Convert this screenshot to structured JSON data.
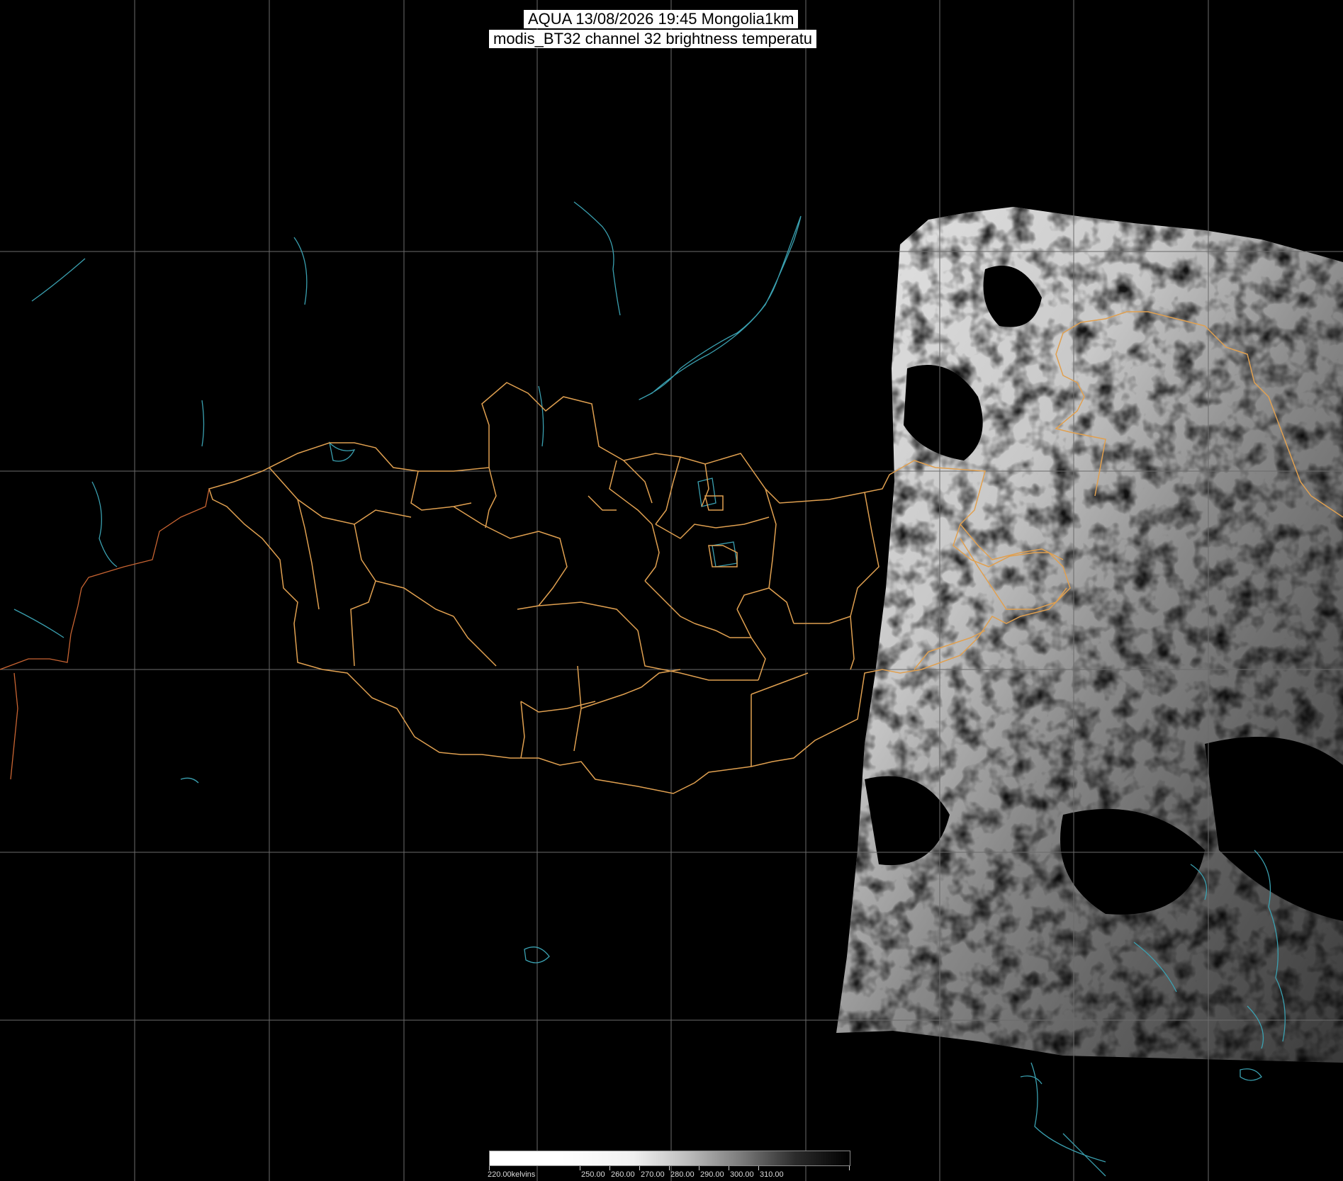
{
  "header": {
    "title_line1": "AQUA 13/08/2026 19:45 Mongolia1km",
    "title_line2": "modis_BT32 channel 32 brightness temperatu"
  },
  "colorbar": {
    "labels": [
      "220.00kelvins",
      "250.00",
      "260.00",
      "270.00",
      "280.00",
      "290.00",
      "300.00",
      "310.00"
    ]
  },
  "colors": {
    "background": "#000000",
    "graticule": "#6b6b6b",
    "border": "#e0a050",
    "water": "#3aa0b0"
  }
}
